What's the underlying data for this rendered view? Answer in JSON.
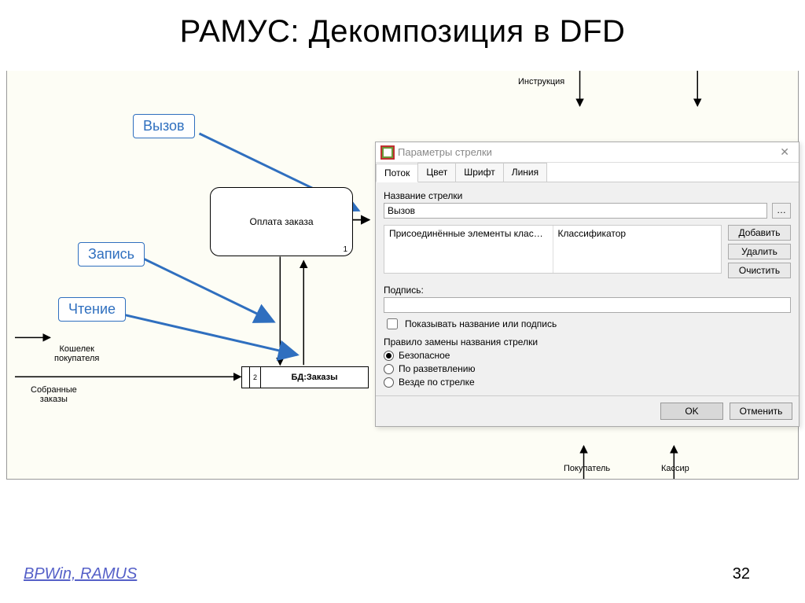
{
  "slide": {
    "title": "РАМУС: Декомпозиция в DFD",
    "footer_link": "BPWin, RAMUS",
    "page": "32"
  },
  "diagram": {
    "callouts": {
      "call": "Вызов",
      "write": "Запись",
      "read": "Чтение"
    },
    "top_labels": {
      "instruction": "Инструкция"
    },
    "process": {
      "label": "Оплата заказа",
      "number": "1"
    },
    "datastore": {
      "number": "2",
      "label": "БД:Заказы"
    },
    "left_labels": {
      "wallet": "Кошелек\nпокупателя",
      "orders": "Собранные\nзаказы"
    },
    "bottom_labels": {
      "buyer": "Покупатель",
      "cashier": "Кассир"
    }
  },
  "dialog": {
    "title": "Параметры стрелки",
    "tabs": [
      "Поток",
      "Цвет",
      "Шрифт",
      "Линия"
    ],
    "active_tab": 0,
    "name_label": "Название стрелки",
    "name_value": "Вызов",
    "ellipsis": "…",
    "columns": [
      "Присоединённые элементы классиф...",
      "Классификатор"
    ],
    "buttons": {
      "add": "Добавить",
      "delete": "Удалить",
      "clear": "Очистить"
    },
    "signature_label": "Подпись:",
    "show_name_or_sig": "Показывать название или подпись",
    "rule_label": "Правило замены названия стрелки",
    "radios": {
      "safe": "Безопасное",
      "branch": "По разветвлению",
      "every": "Везде по стрелке"
    },
    "footer": {
      "ok": "OK",
      "cancel": "Отменить"
    }
  }
}
